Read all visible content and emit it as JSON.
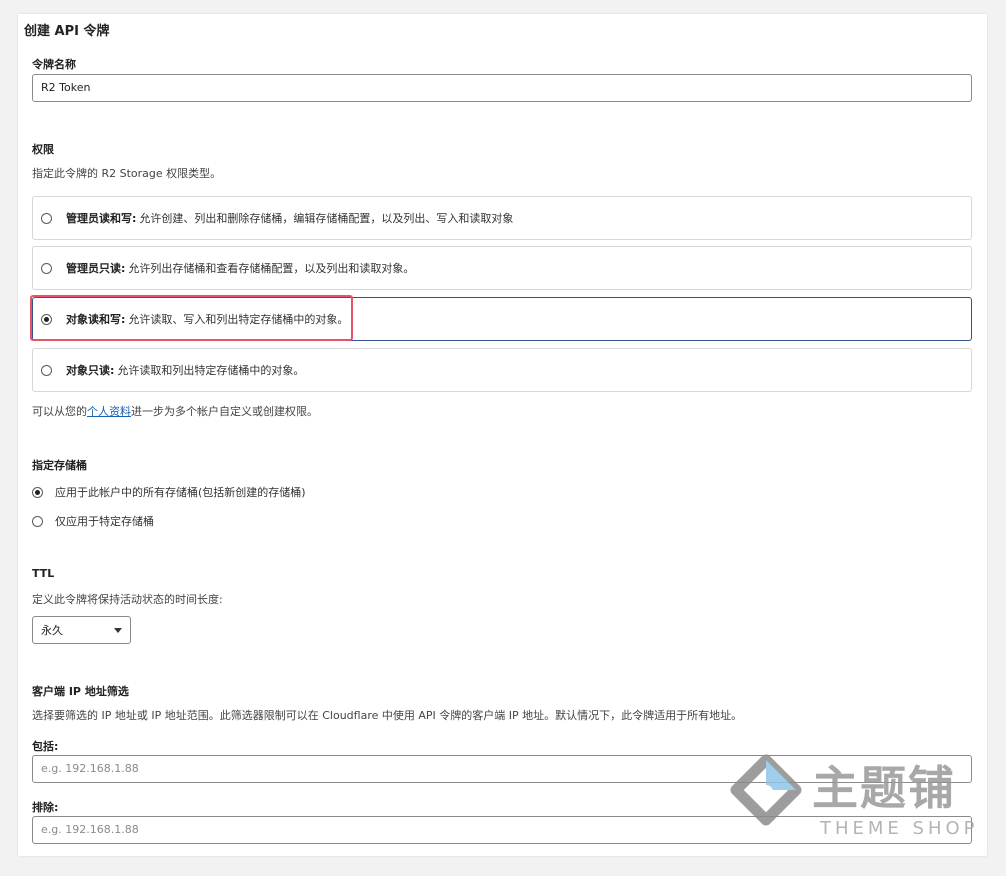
{
  "page_title": "创建 API 令牌",
  "token_name": {
    "label": "令牌名称",
    "value": "R2 Token"
  },
  "permissions": {
    "heading": "权限",
    "description": "指定此令牌的 R2 Storage 权限类型。",
    "options": [
      {
        "name": "管理员读和写:",
        "desc": "允许创建、列出和删除存储桶，编辑存储桶配置，以及列出、写入和读取对象",
        "selected": false
      },
      {
        "name": "管理员只读:",
        "desc": "允许列出存储桶和查看存储桶配置，以及列出和读取对象。",
        "selected": false
      },
      {
        "name": "对象读和写:",
        "desc": "允许读取、写入和列出特定存储桶中的对象。",
        "selected": true
      },
      {
        "name": "对象只读:",
        "desc": "允许读取和列出特定存储桶中的对象。",
        "selected": false
      }
    ],
    "note_prefix": "可以从您的",
    "note_link": "个人资料",
    "note_suffix": "进一步为多个帐户自定义或创建权限。"
  },
  "buckets": {
    "heading": "指定存储桶",
    "options": [
      {
        "label": "应用于此帐户中的所有存储桶(包括新创建的存储桶)",
        "selected": true
      },
      {
        "label": "仅应用于特定存储桶",
        "selected": false
      }
    ]
  },
  "ttl": {
    "heading": "TTL",
    "description": "定义此令牌将保持活动状态的时间长度:",
    "selected": "永久"
  },
  "ip_filter": {
    "heading": "客户端 IP 地址筛选",
    "description": "选择要筛选的 IP 地址或 IP 地址范围。此筛选器限制可以在 Cloudflare 中使用 API 令牌的客户端 IP 地址。默认情况下，此令牌适用于所有地址。",
    "include_label": "包括:",
    "include_placeholder": "e.g. 192.168.1.88",
    "exclude_label": "排除:",
    "exclude_placeholder": "e.g. 192.168.1.88"
  },
  "watermark": {
    "cn": "主题铺",
    "en": "THEME SHOP"
  },
  "colors": {
    "accent_border": "#33528f",
    "highlight": "#e8536a",
    "link": "#1a5fb4"
  }
}
